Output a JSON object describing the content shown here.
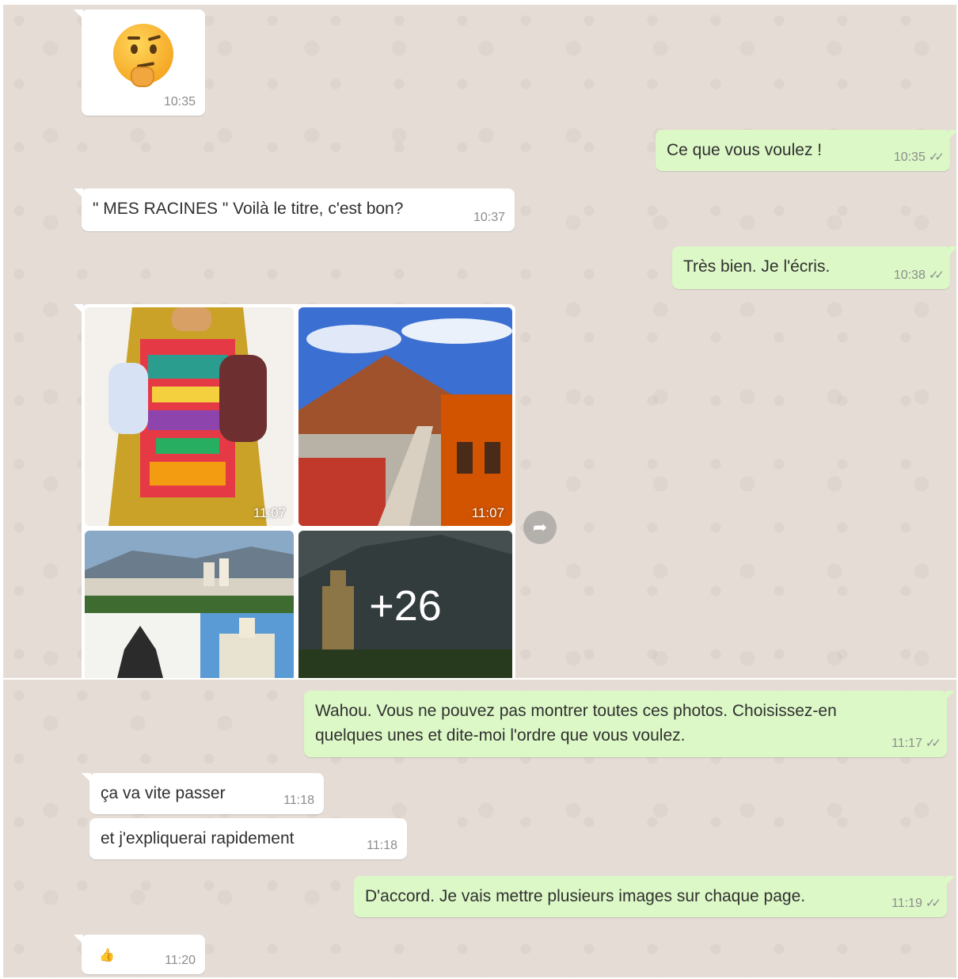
{
  "colors": {
    "incoming": "#ffffff",
    "outgoing": "#dcf8c6",
    "chat_background": "#e5ddd5"
  },
  "messages": [
    {
      "id": "m1",
      "direction": "incoming",
      "type": "emoji",
      "emoji_name": "thinking-face-icon",
      "time": "10:35"
    },
    {
      "id": "m2",
      "direction": "outgoing",
      "text": "Ce que vous voulez !",
      "time": "10:35",
      "status": "read"
    },
    {
      "id": "m3",
      "direction": "incoming",
      "text": "\" MES RACINES \" Voilà le titre, c'est bon?",
      "time": "10:37"
    },
    {
      "id": "m4",
      "direction": "outgoing",
      "text": "Très bien. Je l'écris.",
      "time": "10:38",
      "status": "read"
    },
    {
      "id": "m5",
      "direction": "incoming",
      "type": "photo-album",
      "photos": [
        {
          "label": "traditional-costume-photo",
          "time": "11:07"
        },
        {
          "label": "mountain-city-rooftop-photo",
          "time": "11:07"
        },
        {
          "label": "city-collage-photo"
        },
        {
          "label": "church-mountain-photo",
          "more": "+26"
        }
      ]
    },
    {
      "id": "m6",
      "direction": "outgoing",
      "text_lines": [
        "Wahou. Vous ne pouvez pas montrer toutes ces photos. Choisissez-en",
        "quelques unes et dite-moi l'ordre que vous voulez."
      ],
      "time": "11:17",
      "status": "read"
    },
    {
      "id": "m7",
      "direction": "incoming",
      "text": "ça va vite passer",
      "time": "11:18"
    },
    {
      "id": "m8",
      "direction": "incoming",
      "text": "et j'expliquerai rapidement",
      "time": "11:18"
    },
    {
      "id": "m9",
      "direction": "outgoing",
      "text": "D'accord. Je vais mettre plusieurs images sur chaque page.",
      "time": "11:19",
      "status": "read"
    },
    {
      "id": "m10",
      "direction": "incoming",
      "type": "reaction",
      "icon": "thumbs-up-icon",
      "time": "11:20"
    }
  ],
  "icons": {
    "read_ticks": "✓✓",
    "forward": "➦",
    "thumbs_up": "👍"
  }
}
